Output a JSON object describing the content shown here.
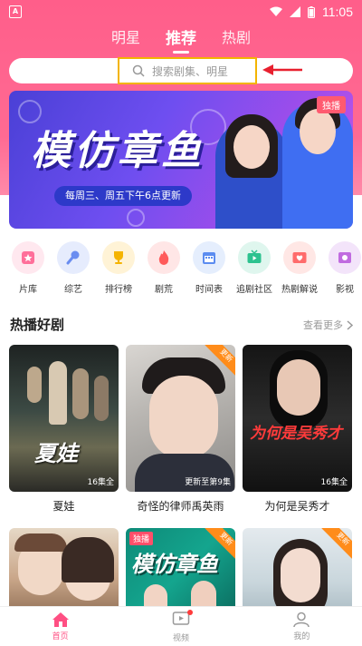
{
  "status": {
    "time": "11:05",
    "left_icon": "A"
  },
  "tabs": [
    {
      "label": "明星"
    },
    {
      "label": "推荐",
      "active": true
    },
    {
      "label": "热剧"
    }
  ],
  "search": {
    "placeholder": "搜索剧集、明星"
  },
  "banner": {
    "title": "模仿章鱼",
    "subtitle": "每周三、周五下午6点更新",
    "tag": "独播"
  },
  "categories": [
    {
      "label": "片库",
      "icon": "library-icon",
      "color": "#ff6f9a",
      "bg": "#ffe8ef"
    },
    {
      "label": "综艺",
      "icon": "microphone-icon",
      "color": "#6a8df0",
      "bg": "#e6ecfd"
    },
    {
      "label": "排行榜",
      "icon": "trophy-icon",
      "color": "#f5b400",
      "bg": "#fff3d6"
    },
    {
      "label": "剧荒",
      "icon": "flame-icon",
      "color": "#ff5a5a",
      "bg": "#ffe6e6"
    },
    {
      "label": "时间表",
      "icon": "calendar-icon",
      "color": "#5b8cf0",
      "bg": "#e5eefd"
    },
    {
      "label": "追剧社区",
      "icon": "tv-icon",
      "color": "#2cc28f",
      "bg": "#dff6ee"
    },
    {
      "label": "热剧解说",
      "icon": "heart-tv-icon",
      "color": "#ff6b6b",
      "bg": "#ffe7e5"
    },
    {
      "label": "影视",
      "icon": "film-icon",
      "color": "#c06be0",
      "bg": "#f3e4fa"
    }
  ],
  "section": {
    "title": "热播好剧",
    "more": "查看更多"
  },
  "cards": [
    {
      "title": "夏娃",
      "badge": "16集全",
      "overlay": "夏娃"
    },
    {
      "title": "奇怪的律师禹英雨",
      "badge": "更新至第9集",
      "corner": "更新"
    },
    {
      "title": "为何是吴秀才",
      "badge": "16集全",
      "overlay": "为何是吴秀才"
    }
  ],
  "cards_row2": [
    {
      "tag": ""
    },
    {
      "tag": "独播",
      "overlay": "模仿章鱼",
      "corner": "更新"
    },
    {
      "tag": "",
      "corner": "更新"
    }
  ],
  "bottom_nav": [
    {
      "label": "首页",
      "icon": "home-icon",
      "active": true
    },
    {
      "label": "视频",
      "icon": "video-icon"
    },
    {
      "label": "我的",
      "icon": "profile-icon"
    }
  ],
  "colors": {
    "brand": "#ff5e8a",
    "highlight": "#f3b400"
  }
}
